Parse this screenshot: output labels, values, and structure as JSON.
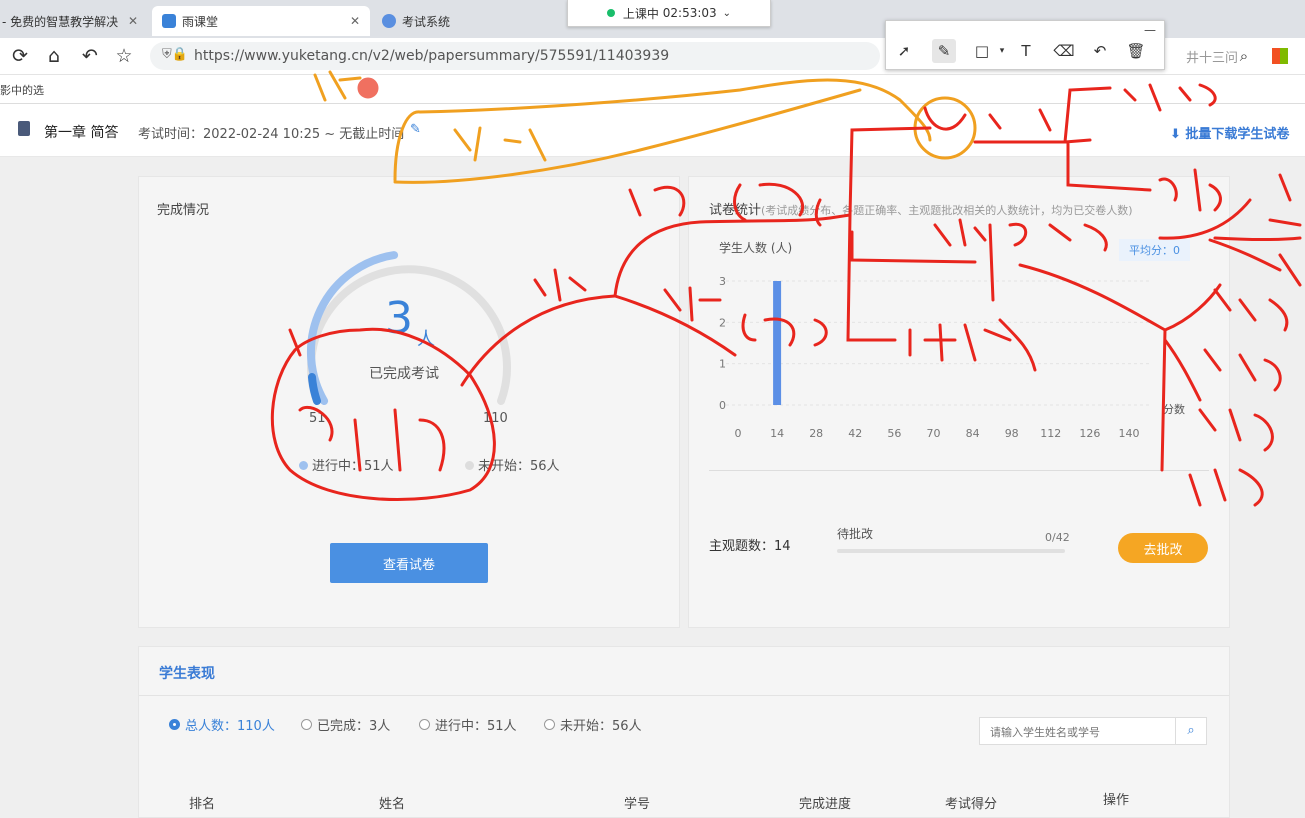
{
  "browser": {
    "tabs": [
      {
        "label": "- 免费的智慧教学解决"
      },
      {
        "label": "雨课堂"
      },
      {
        "label": "考试系统"
      }
    ],
    "url": "https://www.yuketang.cn/v2/web/papersummary/575591/11403939",
    "bookmark": "影中的选",
    "right_text": "井十三问"
  },
  "live": {
    "status": "上课中",
    "time": "02:53:03"
  },
  "header": {
    "chapter": "第一章 简答",
    "exam_time": "考试时间：2022-02-24 10:25 ~ 无截止时间",
    "batch_download": "批量下载学生试卷"
  },
  "completion": {
    "title": "完成情况",
    "completed_count": "3",
    "unit": "人",
    "label": "已完成考试",
    "gauge_min": "51",
    "gauge_max": "110",
    "gauge_fraction": 0.4636,
    "in_progress": "进行中：51人",
    "not_started": "未开始：56人",
    "view_button": "查看试卷"
  },
  "stats": {
    "title": "试卷统计",
    "subtitle": "(考试成绩分布、各题正确率、主观题批改相关的人数统计，均为已交卷人数)",
    "avg": "平均分：0",
    "subjective": "主观题数：14",
    "pending_label": "待批改",
    "pending_count": "0/42",
    "pending_fraction": 0,
    "grade_button": "去批改"
  },
  "chart_data": {
    "type": "bar",
    "ylabel": "学生人数 (人)",
    "xlabel": "分数",
    "x": [
      0,
      14,
      28,
      42,
      56,
      70,
      84,
      98,
      112,
      126,
      140
    ],
    "y_ticks": [
      0,
      1,
      2,
      3
    ],
    "ylim": [
      0,
      3
    ],
    "bars": [
      {
        "x": 14,
        "value": 3
      }
    ],
    "color": "#5b8fe6"
  },
  "students": {
    "title": "学生表现",
    "filters": [
      {
        "label": "总人数：",
        "value": "110人",
        "selected": true
      },
      {
        "label": "已完成：3人",
        "value": "",
        "selected": false
      },
      {
        "label": "进行中：51人",
        "value": "",
        "selected": false
      },
      {
        "label": "未开始：56人",
        "value": "",
        "selected": false
      }
    ],
    "search_placeholder": "请输入学生姓名或学号",
    "columns": [
      "排名",
      "姓名",
      "学号",
      "完成进度",
      "考试得分",
      "操作"
    ]
  },
  "annotations": {
    "color_red": "#e8251d",
    "color_orange": "#f0a020"
  }
}
